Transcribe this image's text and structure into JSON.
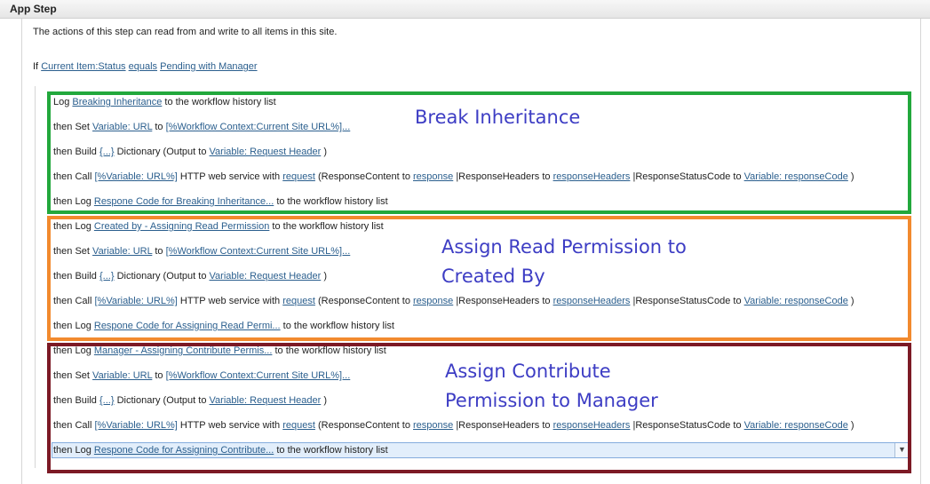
{
  "header": {
    "title": "App Step"
  },
  "description": "The actions of this step can read from and write to all items in this site.",
  "condition": {
    "if": "If",
    "field": "Current Item:Status",
    "op": "equals",
    "value": "Pending with Manager"
  },
  "groups": [
    {
      "annotation": [
        "Break Inheritance"
      ],
      "lines": [
        [
          {
            "t": "Log "
          },
          {
            "t": "Breaking Inheritance",
            "l": 1
          },
          {
            "t": " to the workflow history list"
          }
        ],
        [
          {
            "t": "then Set "
          },
          {
            "t": "Variable: URL",
            "l": 1
          },
          {
            "t": " to "
          },
          {
            "t": "[%Workflow Context:Current Site URL%]...",
            "l": 1
          }
        ],
        [
          {
            "t": "then Build "
          },
          {
            "t": "{...}",
            "l": 1
          },
          {
            "t": " Dictionary (Output to "
          },
          {
            "t": "Variable: Request Header",
            "l": 1
          },
          {
            "t": " )"
          }
        ],
        [
          {
            "t": "then Call "
          },
          {
            "t": "[%Variable: URL%]",
            "l": 1
          },
          {
            "t": " HTTP web service with "
          },
          {
            "t": "request",
            "l": 1
          },
          {
            "t": " (ResponseContent to "
          },
          {
            "t": "response",
            "l": 1
          },
          {
            "t": " |ResponseHeaders to "
          },
          {
            "t": "responseHeaders",
            "l": 1
          },
          {
            "t": " |ResponseStatusCode to "
          },
          {
            "t": "Variable: responseCode",
            "l": 1
          },
          {
            "t": " )"
          }
        ],
        [
          {
            "t": "then Log "
          },
          {
            "t": "Respone Code for Breaking Inheritance...",
            "l": 1
          },
          {
            "t": " to the workflow history list"
          }
        ]
      ]
    },
    {
      "annotation": [
        "Assign Read Permission to",
        "Created By"
      ],
      "lines": [
        [
          {
            "t": "then Log "
          },
          {
            "t": "Created by - Assigning Read Permission",
            "l": 1
          },
          {
            "t": " to the workflow history list"
          }
        ],
        [
          {
            "t": "then Set "
          },
          {
            "t": "Variable: URL",
            "l": 1
          },
          {
            "t": " to "
          },
          {
            "t": "[%Workflow Context:Current Site URL%]...",
            "l": 1
          }
        ],
        [
          {
            "t": "then Build "
          },
          {
            "t": "{...}",
            "l": 1
          },
          {
            "t": " Dictionary (Output to "
          },
          {
            "t": "Variable: Request Header",
            "l": 1
          },
          {
            "t": " )"
          }
        ],
        [
          {
            "t": "then Call "
          },
          {
            "t": "[%Variable: URL%]",
            "l": 1
          },
          {
            "t": " HTTP web service with "
          },
          {
            "t": "request",
            "l": 1
          },
          {
            "t": " (ResponseContent to "
          },
          {
            "t": "response",
            "l": 1
          },
          {
            "t": " |ResponseHeaders to "
          },
          {
            "t": "responseHeaders",
            "l": 1
          },
          {
            "t": " |ResponseStatusCode to "
          },
          {
            "t": "Variable: responseCode",
            "l": 1
          },
          {
            "t": " )"
          }
        ],
        [
          {
            "t": "then Log "
          },
          {
            "t": "Respone Code for Assigning Read Permi...",
            "l": 1
          },
          {
            "t": " to the workflow history list"
          }
        ]
      ]
    },
    {
      "annotation": [
        "Assign Contribute",
        "Permission to Manager"
      ],
      "lines": [
        [
          {
            "t": "then Log "
          },
          {
            "t": "Manager - Assigning Contribute Permis...",
            "l": 1
          },
          {
            "t": " to the workflow history list"
          }
        ],
        [
          {
            "t": "then Set "
          },
          {
            "t": "Variable: URL",
            "l": 1
          },
          {
            "t": " to "
          },
          {
            "t": "[%Workflow Context:Current Site URL%]...",
            "l": 1
          }
        ],
        [
          {
            "t": "then Build "
          },
          {
            "t": "{...}",
            "l": 1
          },
          {
            "t": " Dictionary (Output to "
          },
          {
            "t": "Variable: Request Header",
            "l": 1
          },
          {
            "t": " )"
          }
        ],
        [
          {
            "t": "then Call "
          },
          {
            "t": "[%Variable: URL%]",
            "l": 1
          },
          {
            "t": " HTTP web service with "
          },
          {
            "t": "request",
            "l": 1
          },
          {
            "t": " (ResponseContent to "
          },
          {
            "t": "response",
            "l": 1
          },
          {
            "t": " |ResponseHeaders to "
          },
          {
            "t": "responseHeaders",
            "l": 1
          },
          {
            "t": " |ResponseStatusCode to "
          },
          {
            "t": "Variable: responseCode",
            "l": 1
          },
          {
            "t": " )"
          }
        ],
        [
          {
            "t": "then Log "
          },
          {
            "t": "Respone Code for Assigning Contribute...",
            "l": 1
          },
          {
            "t": " to the workflow history list"
          }
        ]
      ]
    }
  ],
  "colors": {
    "green": "#22a83c",
    "orange": "#f28a2e",
    "maroon": "#7c1a25",
    "annotation": "#3d3dc4",
    "link": "#2b5f8e",
    "selected": "#e2eefb"
  },
  "icons": {
    "dropdown": "chevron-down-icon"
  },
  "selected_line": {
    "group": 2,
    "line": 4
  }
}
